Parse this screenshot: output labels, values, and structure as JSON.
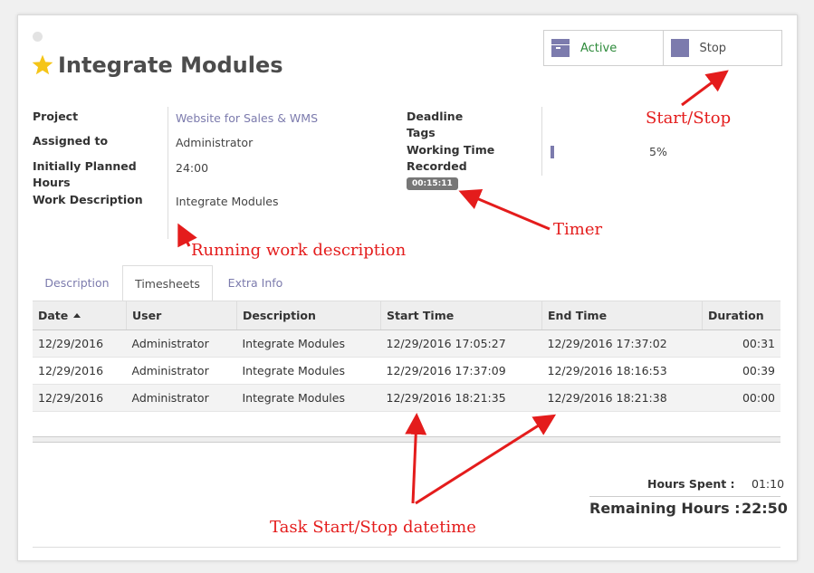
{
  "task": {
    "title": "Integrate Modules"
  },
  "stat_buttons": {
    "active_label": "Active",
    "stop_label": "Stop"
  },
  "fields": {
    "project_label": "Project",
    "project_value": "Website for Sales & WMS",
    "assigned_label": "Assigned to",
    "assigned_value": "Administrator",
    "planned_label": "Initially Planned Hours",
    "planned_value": "24:00",
    "work_desc_label": "Work Description",
    "work_desc_value": "Integrate Modules",
    "deadline_label": "Deadline",
    "tags_label": "Tags",
    "working_time_label": "Working Time Recorded",
    "timer_value": "00:15:11",
    "progress_text": "5%",
    "progress_fraction": 0.05
  },
  "tabs": [
    "Description",
    "Timesheets",
    "Extra Info"
  ],
  "active_tab": "Timesheets",
  "timesheet": {
    "columns": [
      "Date",
      "User",
      "Description",
      "Start Time",
      "End Time",
      "Duration"
    ],
    "rows": [
      [
        "12/29/2016",
        "Administrator",
        "Integrate Modules",
        "12/29/2016 17:05:27",
        "12/29/2016 17:37:02",
        "00:31"
      ],
      [
        "12/29/2016",
        "Administrator",
        "Integrate Modules",
        "12/29/2016 17:37:09",
        "12/29/2016 18:16:53",
        "00:39"
      ],
      [
        "12/29/2016",
        "Administrator",
        "Integrate Modules",
        "12/29/2016 18:21:35",
        "12/29/2016 18:21:38",
        "00:00"
      ]
    ]
  },
  "summary": {
    "hours_spent_label": "Hours Spent :",
    "hours_spent_value": "01:10",
    "remaining_label": "Remaining Hours :",
    "remaining_value": "22:50"
  },
  "annotations": {
    "start_stop": "Start/Stop",
    "timer": "Timer",
    "running_desc": "Running work description",
    "task_datetime": "Task Start/Stop datetime"
  },
  "colors": {
    "accent": "#7c7bad",
    "annotation": "#e41c1c",
    "active_green": "#2d8a3a",
    "star": "#f5c518"
  }
}
